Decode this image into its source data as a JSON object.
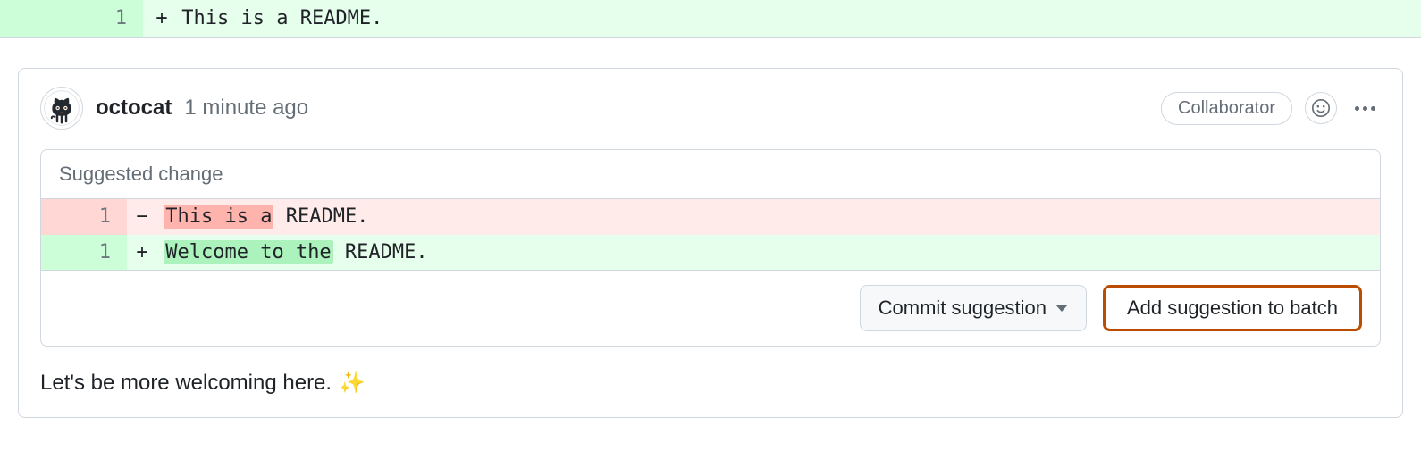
{
  "top_diff": {
    "line_number": "1",
    "sign": "+",
    "text": "This is a README."
  },
  "comment": {
    "author": "octocat",
    "timestamp": "1 minute ago",
    "role_badge": "Collaborator",
    "body_text": "Let's be more welcoming here.",
    "sparkle": "✨"
  },
  "suggestion": {
    "title": "Suggested change",
    "deletion": {
      "line_number": "1",
      "sign": "−",
      "highlighted": "This is a",
      "rest": " README."
    },
    "addition": {
      "line_number": "1",
      "sign": "+",
      "highlighted": "Welcome to the",
      "rest": " README."
    },
    "buttons": {
      "commit": "Commit suggestion",
      "add_batch": "Add suggestion to batch"
    }
  }
}
